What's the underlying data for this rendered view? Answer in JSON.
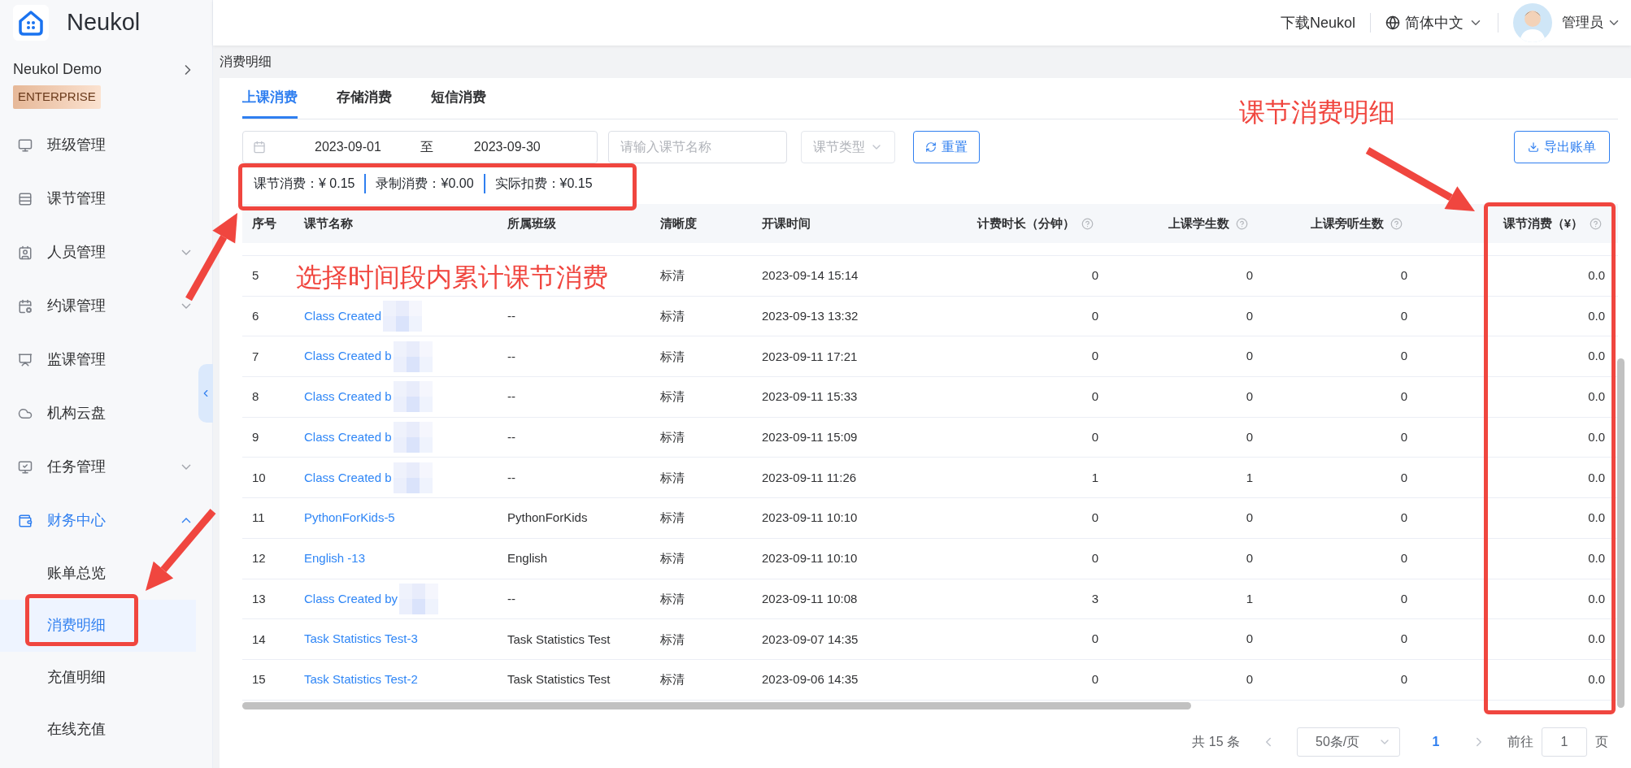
{
  "header": {
    "brand": "Neukol",
    "download": "下载Neukol",
    "language": "简体中文",
    "user": "管理员"
  },
  "sidebar": {
    "org": "Neukol Demo",
    "badge": "ENTERPRISE",
    "items": [
      {
        "label": "班级管理",
        "selected": false
      },
      {
        "label": "课节管理",
        "selected": false
      },
      {
        "label": "人员管理",
        "selected": false,
        "expanded": false
      },
      {
        "label": "约课管理",
        "selected": false,
        "expanded": false
      },
      {
        "label": "监课管理",
        "selected": false
      },
      {
        "label": "机构云盘",
        "selected": false
      },
      {
        "label": "任务管理",
        "selected": false,
        "expanded": false
      },
      {
        "label": "财务中心",
        "selected": false,
        "expanded": true,
        "children": [
          {
            "label": "账单总览",
            "selected": false
          },
          {
            "label": "消费明细",
            "selected": true
          },
          {
            "label": "充值明细",
            "selected": false
          },
          {
            "label": "在线充值",
            "selected": false
          }
        ]
      }
    ]
  },
  "breadcrumb": "消费明细",
  "tabs": [
    {
      "label": "上课消费",
      "selected": true
    },
    {
      "label": "存储消费",
      "selected": false
    },
    {
      "label": "短信消费",
      "selected": false
    }
  ],
  "filters": {
    "date_start": "2023-09-01",
    "date_separator": "至",
    "date_end": "2023-09-30",
    "name_placeholder": "请输入课节名称",
    "type_placeholder": "课节类型",
    "reset": "重置",
    "export": "导出账单"
  },
  "summary": [
    "课节消费：¥ 0.15",
    "录制消费：¥0.00",
    "实际扣费：¥0.15"
  ],
  "table": {
    "columns": [
      {
        "label": "序号",
        "help": false
      },
      {
        "label": "课节名称",
        "help": false
      },
      {
        "label": "所属班级",
        "help": false
      },
      {
        "label": "清晰度",
        "help": false
      },
      {
        "label": "开课时间",
        "help": false
      },
      {
        "label": "计费时长（分钟）",
        "help": true
      },
      {
        "label": "上课学生数",
        "help": true
      },
      {
        "label": "上课旁听生数",
        "help": true
      },
      {
        "label": "课节消费（¥）",
        "help": true
      }
    ],
    "rows": [
      {
        "no": "5",
        "clarity": "标清",
        "start": "2023-09-14 15:14",
        "minutes": "0",
        "students": "0",
        "auditors": "0",
        "cost": "0.0"
      },
      {
        "no": "6",
        "name": "Class Created",
        "blurred": true,
        "class": "--",
        "clarity": "标清",
        "start": "2023-09-13 13:32",
        "minutes": "0",
        "students": "0",
        "auditors": "0",
        "cost": "0.0"
      },
      {
        "no": "7",
        "name": "Class Created b",
        "blurred": true,
        "class": "--",
        "clarity": "标清",
        "start": "2023-09-11 17:21",
        "minutes": "0",
        "students": "0",
        "auditors": "0",
        "cost": "0.0"
      },
      {
        "no": "8",
        "name": "Class Created b",
        "blurred": true,
        "class": "--",
        "clarity": "标清",
        "start": "2023-09-11 15:33",
        "minutes": "0",
        "students": "0",
        "auditors": "0",
        "cost": "0.0"
      },
      {
        "no": "9",
        "name": "Class Created b",
        "blurred": true,
        "class": "--",
        "clarity": "标清",
        "start": "2023-09-11 15:09",
        "minutes": "0",
        "students": "0",
        "auditors": "0",
        "cost": "0.0"
      },
      {
        "no": "10",
        "name": "Class Created b",
        "blurred": true,
        "class": "--",
        "clarity": "标清",
        "start": "2023-09-11 11:26",
        "minutes": "1",
        "students": "1",
        "auditors": "0",
        "cost": "0.0"
      },
      {
        "no": "11",
        "name": "PythonForKids-5",
        "blurred": false,
        "class": "PythonForKids",
        "clarity": "标清",
        "start": "2023-09-11 10:10",
        "minutes": "0",
        "students": "0",
        "auditors": "0",
        "cost": "0.0"
      },
      {
        "no": "12",
        "name": "English -13",
        "blurred": false,
        "class": "English",
        "clarity": "标清",
        "start": "2023-09-11 10:10",
        "minutes": "0",
        "students": "0",
        "auditors": "0",
        "cost": "0.0"
      },
      {
        "no": "13",
        "name": "Class Created by",
        "blurred": true,
        "class": "--",
        "clarity": "标清",
        "start": "2023-09-11 10:08",
        "minutes": "3",
        "students": "1",
        "auditors": "0",
        "cost": "0.0"
      },
      {
        "no": "14",
        "name": "Task Statistics Test-3",
        "blurred": false,
        "class": "Task Statistics Test",
        "clarity": "标清",
        "start": "2023-09-07 14:35",
        "minutes": "0",
        "students": "0",
        "auditors": "0",
        "cost": "0.0"
      },
      {
        "no": "15",
        "name": "Task Statistics Test-2",
        "blurred": false,
        "class": "Task Statistics Test",
        "clarity": "标清",
        "start": "2023-09-06 14:35",
        "minutes": "0",
        "students": "0",
        "auditors": "0",
        "cost": "0.0"
      }
    ]
  },
  "pagination": {
    "total": "共 15 条",
    "page_size": "50条/页",
    "pages": [
      {
        "label": "1",
        "selected": true
      }
    ],
    "goto": "前往",
    "goto_value": "1",
    "goto_suffix": "页"
  },
  "annotations": {
    "notes": [
      "课节消费明细",
      "选择时间段内累计课节消费"
    ]
  }
}
